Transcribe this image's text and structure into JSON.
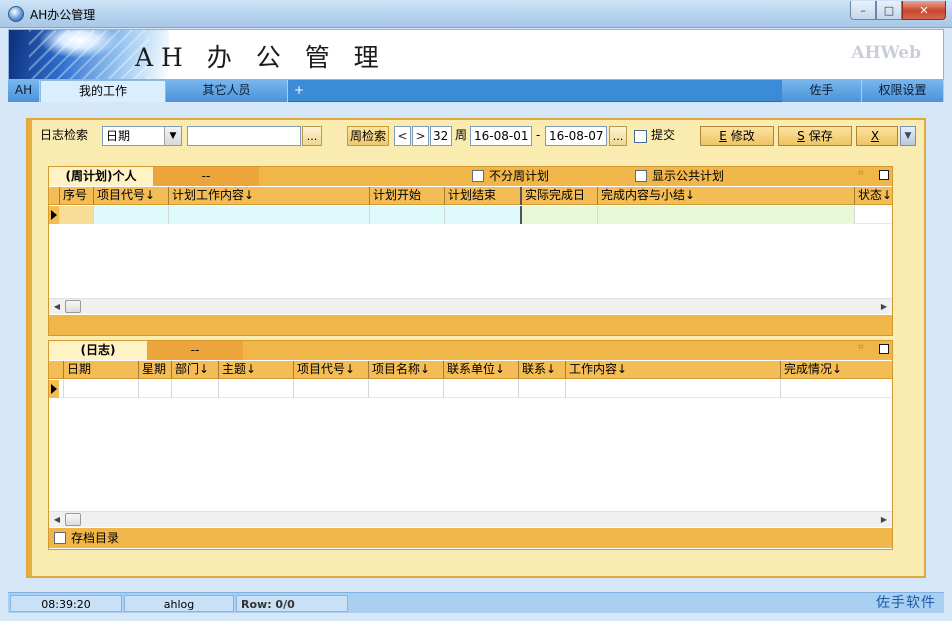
{
  "window": {
    "title": "AH办公管理",
    "min": "–",
    "max": "□",
    "close": "✕"
  },
  "banner": {
    "app_name": "AH 办 公 管 理",
    "brand": "AHWeb"
  },
  "nav": {
    "tabs": [
      "AH",
      "我的工作",
      "其它人员",
      "+"
    ],
    "right_tabs": [
      "佐手",
      "权限设置"
    ]
  },
  "toolbar": {
    "log_search_label": "日志检索",
    "field_select": "日期",
    "search_value": "",
    "dots": "...",
    "week_search_label": "周检索",
    "prev_week": "<",
    "next_week": ">",
    "week_number": "32",
    "week_unit": "周",
    "date_from": "16-08-01",
    "date_sep": "-",
    "date_to": "16-08-07",
    "submit_label": "提交",
    "edit_hotkey": "E",
    "edit_label": "修改",
    "save_hotkey": "S",
    "save_label": "保存",
    "close_hotkey": "X",
    "collapse_icon": "chevron-down-icon",
    "collapse_glyph": "▼"
  },
  "weekly_panel": {
    "tab_active": "(周计划)个人",
    "tab_inactive": "--",
    "opt_no_weekly": "不分周计划",
    "opt_public": "显示公共计划",
    "pin": "⌗",
    "columns": [
      "序号",
      "项目代号↓",
      "计划工作内容↓",
      "计划开始",
      "计划结束",
      "实际完成日",
      "完成内容与小结↓",
      "状态↓"
    ]
  },
  "log_panel": {
    "tab_active": "(日志)",
    "tab_inactive": "--",
    "pin": "⌗",
    "columns": [
      "日期",
      "星期",
      "部门↓",
      "主题↓",
      "项目代号↓",
      "项目名称↓",
      "联系单位↓",
      "联系↓",
      "工作内容↓",
      "完成情况↓"
    ],
    "archive_label": "存档目录"
  },
  "scroll": {
    "left": "◀",
    "right": "▶"
  },
  "status": {
    "time": "08:39:20",
    "user": "ahlog",
    "row": "Row: 0/0",
    "brand": "佐手软件"
  },
  "colors": {
    "accent": "#f1b649",
    "panel_bg": "#faebb0",
    "nav_blue": "#3c8bd6"
  }
}
